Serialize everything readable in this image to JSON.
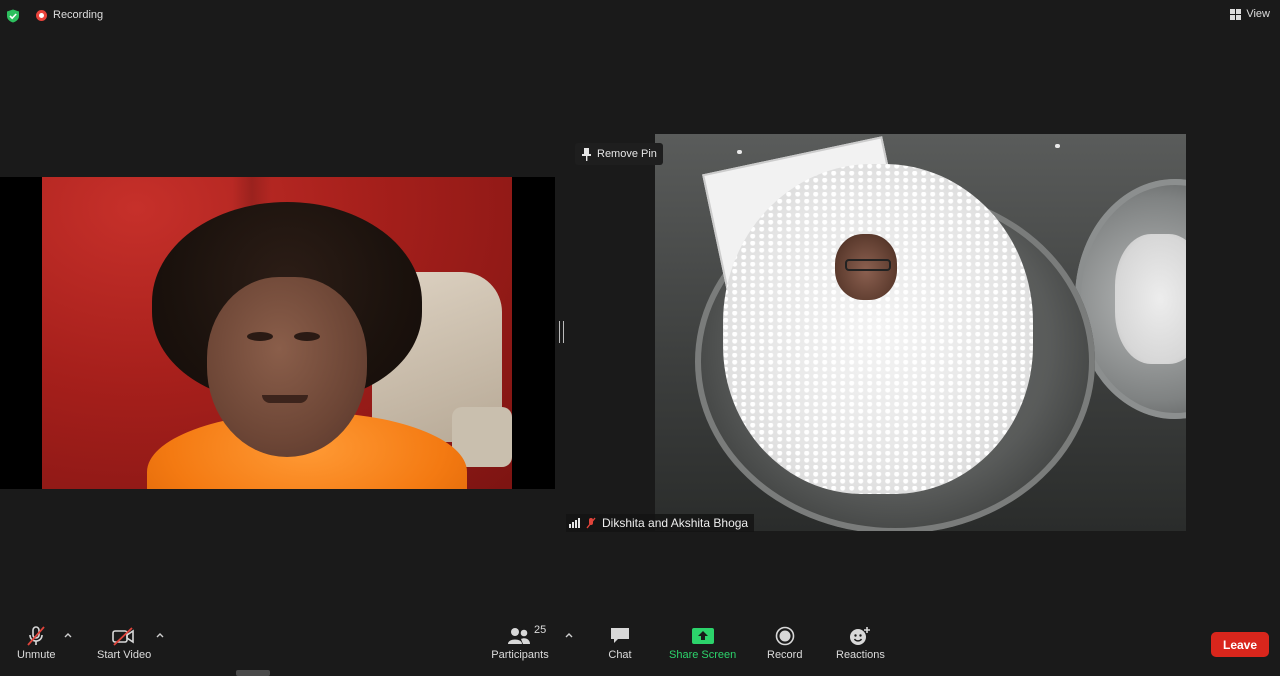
{
  "topbar": {
    "security_icon": "shield-check-icon",
    "recording_label": "Recording",
    "view_label": "View"
  },
  "remove_pin_label": "Remove Pin",
  "participant_name": "Dikshita and Akshita  Bhoga",
  "toolbar": {
    "unmute_label": "Unmute",
    "start_video_label": "Start Video",
    "participants_label": "Participants",
    "participants_count": "25",
    "chat_label": "Chat",
    "share_screen_label": "Share Screen",
    "record_label": "Record",
    "reactions_label": "Reactions",
    "leave_label": "Leave"
  },
  "colors": {
    "background": "#1a1a1a",
    "recording_red": "#e9433b",
    "share_green": "#2cd36b",
    "leave_red": "#d9261c",
    "security_green": "#2dbf5e"
  }
}
